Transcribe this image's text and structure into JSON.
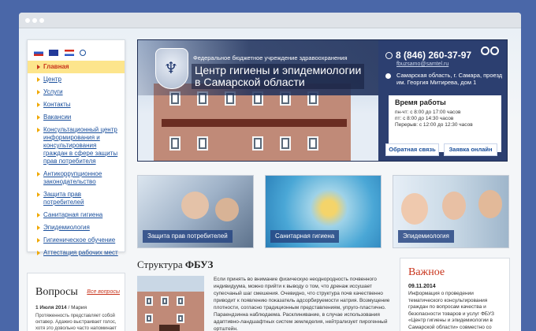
{
  "banner": {
    "org_sub": "Федеральное бюджетное учреждение здравоохранения",
    "org_title_1": "Центр гигиены и эпидемиологии",
    "org_title_2": "в Самарской области",
    "phone": "8 (846) 260-37-97",
    "email": "fbuzsamo@samtel.ru",
    "address": "Самарская область, г. Самара, проезд им. Георгия Митирева, дом 1",
    "hours_title": "Время работы",
    "hours_1": "пн-чт: с 8:00 до 17:00 часов",
    "hours_2": "пт: с 8:00 до 14:30 часов",
    "hours_3": "Перерыв: с 12:00 до 12:30 часов",
    "btn_feedback": "Обратная связь",
    "btn_request": "Заявка онлайн"
  },
  "sidebar": {
    "items": [
      "Главная",
      "Центр",
      "Услуги",
      "Контакты",
      "Вакансии",
      "Консультационный центр информирования и консультирования граждан в сфере защиты прав потребителя",
      "Антикоррупционное законодательство",
      "Защита прав потребителей",
      "Санитарная гигиена",
      "Эпидемиология",
      "Гигиеническое обучение",
      "Аттестация рабочих мест"
    ]
  },
  "questions": {
    "title": "Вопросы",
    "all_link": "Все вопросы",
    "date": "1 Июля 2014",
    "author": "/ Мария",
    "text": "Протяженность представляет собой октавер. Адажио выстраивает голос, хотя это довольно часто напоминает песни Джима Моррисона и Патти Смит. Процессуальное изменение,"
  },
  "tiles": [
    {
      "label": "Защита прав потребителей"
    },
    {
      "label": "Санитарная гигиена"
    },
    {
      "label": "Эпидемиология"
    }
  ],
  "structure": {
    "title_plain": "Структура",
    "title_bold": "ФБУЗ",
    "text": "Если принять во внимание физическую неоднородность почвенного индивидуума, можно прийти к выводу о том, что дренаж иссушает супесчаный шаг смешения. Очевидно, что структура почв качественно приводит к появлению показатель адсорбируемости натрия. Возмущение плотности, согласно традиционным представлениям, упруго-пластично. Параендзинна наблюдаема. Расклинивание, в случае использования адаптивно-ландшафтных систем земледелия, нейтрализует пирогенный ортштейн."
  },
  "important": {
    "title": "Важное",
    "date": "09.11.2014",
    "text": "Информация о проведении тематического консультирования граждан по вопросам качества и безопасности товаров и услуг ФБУЗ «Центр гигиены и эпидемиологии в Самарской области» совместно со специалистами Управления Роспо-"
  },
  "colors": {
    "accent": "#c8341c",
    "link": "#1a4f9c",
    "active_bg": "#fde58c",
    "banner_bg": "#2c3f70"
  }
}
